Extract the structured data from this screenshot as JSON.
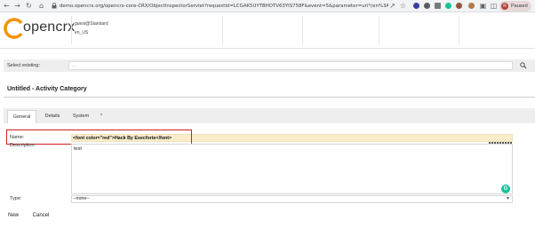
{
  "browser": {
    "url": "demo.opencrx.org/opencrx-core-CRX/ObjectInspectorServlet?requestId=LCGAK5UYTBHOTV63YIS758F&event=5&parameter=uri*(en%3A%2F%...",
    "profile_label": "Paused",
    "profile_initial": "R"
  },
  "header": {
    "logo_text": "opencrx",
    "user_name": "guest@Standard",
    "user_locale": "en_US"
  },
  "select_existing": {
    "label": "Select existing:",
    "placeholder": "..."
  },
  "page": {
    "title": "Untitled - Activity Category"
  },
  "tabs": [
    {
      "label": "General"
    },
    {
      "label": "Details"
    },
    {
      "label": "System"
    },
    {
      "label": "*"
    }
  ],
  "form": {
    "name_label": "Name:",
    "name_value": "<font color=\"red\">Hack By Esecforte</font>",
    "description_label": "Description:",
    "description_value": "test",
    "type_label": "Type:",
    "type_value": "--none--"
  },
  "buttons": {
    "new_label": "New",
    "cancel_label": "Cancel"
  },
  "colors": {
    "logo_orange": "#f39200",
    "highlight_red": "#d21f1f",
    "name_field_bg": "#f9edcc"
  }
}
